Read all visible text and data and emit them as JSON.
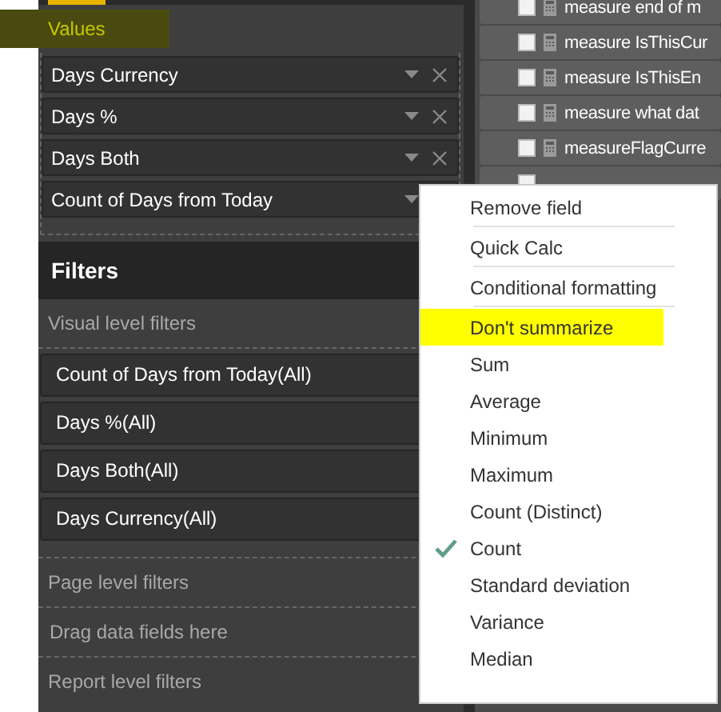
{
  "values_section": {
    "label": "Values",
    "highlighted": true,
    "fields": [
      {
        "name": "Days Currency"
      },
      {
        "name": "Days %"
      },
      {
        "name": "Days Both"
      },
      {
        "name": "Count of Days from Today"
      }
    ]
  },
  "filters": {
    "title": "Filters",
    "visual_label": "Visual level filters",
    "visual_filters": [
      "Count of Days from Today(All)",
      "Days %(All)",
      "Days Both(All)",
      "Days Currency(All)"
    ],
    "page_label": "Page level filters",
    "drop_hint": "Drag data fields here",
    "report_label": "Report level filters"
  },
  "field_list": [
    {
      "kind": "measure",
      "name": "measure end of m",
      "checked": false
    },
    {
      "kind": "measure",
      "name": "measure IsThisCur",
      "checked": false
    },
    {
      "kind": "measure",
      "name": "measure IsThisEn",
      "checked": false
    },
    {
      "kind": "measure",
      "name": "measure what dat",
      "checked": false
    },
    {
      "kind": "measure",
      "name": "measureFlagCurre",
      "checked": false
    },
    {
      "kind": "column",
      "checked": false
    }
  ],
  "context_menu": [
    {
      "kind": "action",
      "label": "Remove field",
      "separator_after": true
    },
    {
      "kind": "action",
      "label": "Quick Calc",
      "separator_after": true
    },
    {
      "kind": "action",
      "label": "Conditional formatting",
      "separator_after": true
    },
    {
      "kind": "aggregation",
      "label": "Don't summarize",
      "checked": false,
      "highlighted": true
    },
    {
      "kind": "aggregation",
      "label": "Sum",
      "checked": false
    },
    {
      "kind": "aggregation",
      "label": "Average",
      "checked": false
    },
    {
      "kind": "aggregation",
      "label": "Minimum",
      "checked": false
    },
    {
      "kind": "aggregation",
      "label": "Maximum",
      "checked": false
    },
    {
      "kind": "aggregation",
      "label": "Count (Distinct)",
      "checked": false
    },
    {
      "kind": "aggregation",
      "label": "Count",
      "checked": true
    },
    {
      "kind": "aggregation",
      "label": "Standard deviation",
      "checked": false
    },
    {
      "kind": "aggregation",
      "label": "Variance",
      "checked": false
    },
    {
      "kind": "aggregation",
      "label": "Median",
      "checked": false
    }
  ]
}
